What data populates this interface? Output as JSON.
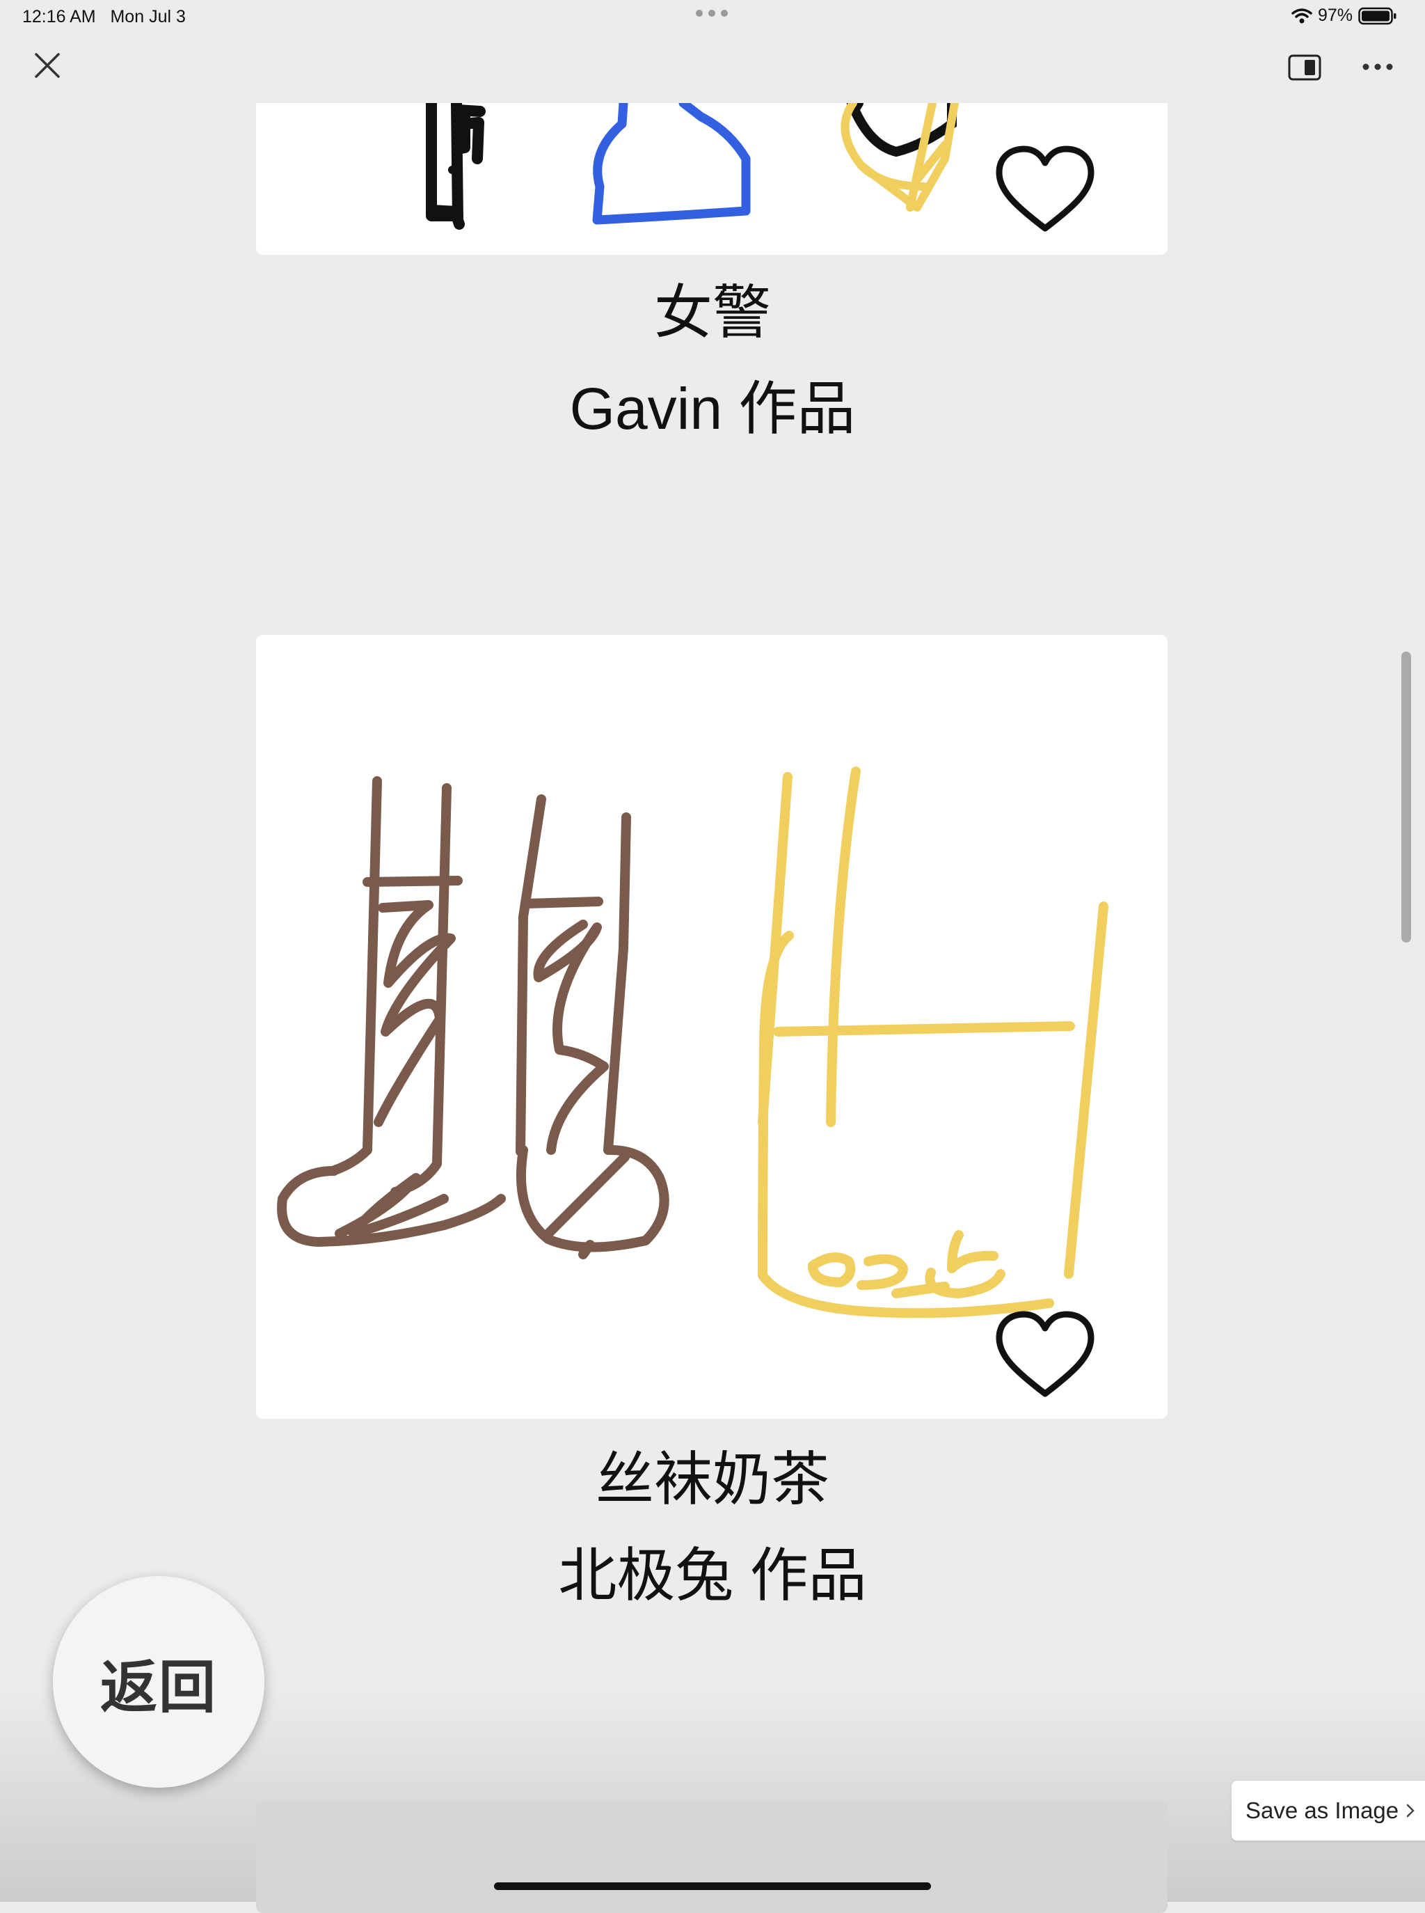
{
  "status_bar": {
    "time": "12:16 AM",
    "date": "Mon Jul 3",
    "battery": "97%",
    "icons": [
      "wifi-icon",
      "battery-icon"
    ]
  },
  "toolbar": {
    "icons": [
      "close-icon",
      "sidebar-toggle-icon",
      "more-icon"
    ]
  },
  "gallery": [
    {
      "title": "女警",
      "author": "Gavin 作品",
      "icon": "heart-icon"
    },
    {
      "title": "丝袜奶茶",
      "author": "北极兔 作品",
      "icon": "heart-icon"
    }
  ],
  "back_button": {
    "label": "返回"
  },
  "save_button": {
    "label": "Save as Image",
    "icon": "chevron-right-icon"
  },
  "colors": {
    "brown": "#7a5a4a",
    "yellow": "#f0cf5e",
    "blue": "#3360e0",
    "background": "#ececec"
  }
}
